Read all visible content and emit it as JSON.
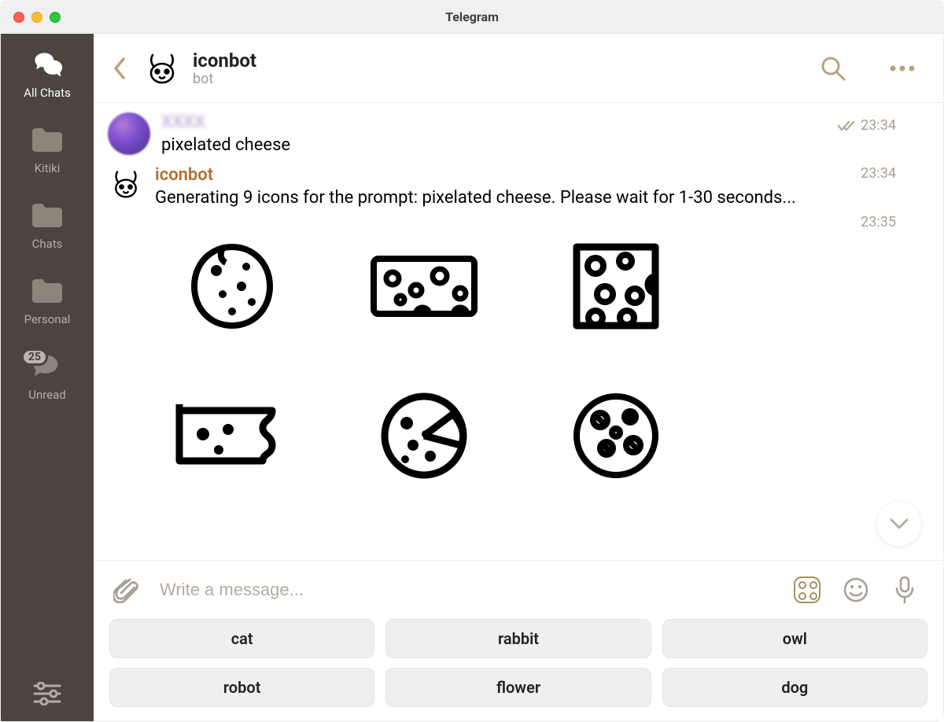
{
  "window": {
    "title": "Telegram"
  },
  "rail": {
    "items": [
      {
        "label": "All Chats"
      },
      {
        "label": "Kitiki"
      },
      {
        "label": "Chats"
      },
      {
        "label": "Personal"
      },
      {
        "label": "Unread",
        "badge": "25"
      }
    ]
  },
  "header": {
    "title": "iconbot",
    "subtitle": "bot"
  },
  "messages": {
    "m0": {
      "name": "user",
      "text": "pixelated cheese",
      "time": "23:34"
    },
    "m1": {
      "name": "iconbot",
      "text": "Generating 9 icons for the prompt: pixelated cheese. Please wait for 1-30 seconds...",
      "time": "23:34"
    },
    "m2": {
      "time": "23:35"
    }
  },
  "composer": {
    "placeholder": "Write a message..."
  },
  "suggestions": [
    "cat",
    "rabbit",
    "owl",
    "robot",
    "flower",
    "dog"
  ]
}
